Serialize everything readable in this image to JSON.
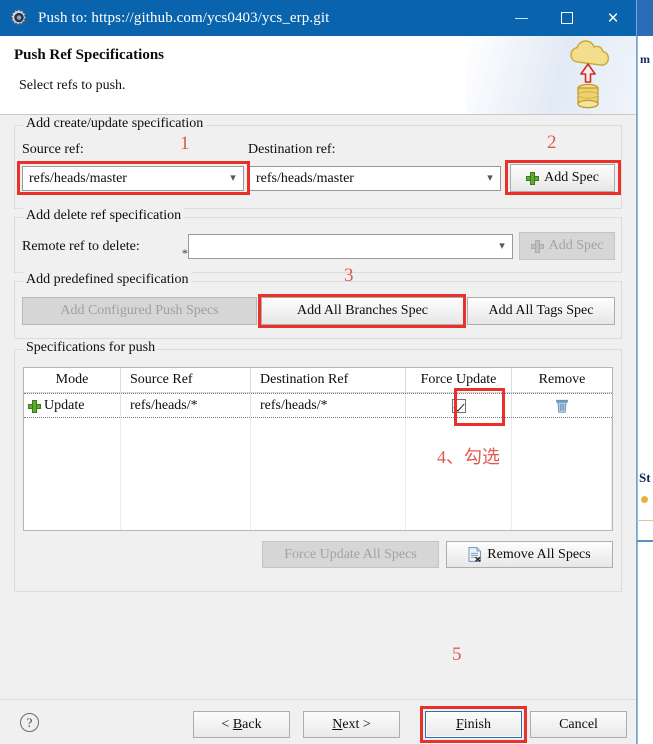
{
  "window": {
    "title": "Push to: https://github.com/ycs0403/ycs_erp.git",
    "icon": "gear-icon",
    "minimize_label": "–",
    "maximize_label": "□",
    "close_label": "×"
  },
  "banner": {
    "title": "Push Ref Specifications",
    "subtitle": "Select refs to push.",
    "art": "cloud-upload-database-icon"
  },
  "create_update_group": {
    "legend": "Add create/update specification",
    "source_label": "Source ref:",
    "source_value": "refs/heads/master",
    "destination_label": "Destination ref:",
    "destination_value": "refs/heads/master",
    "add_spec_label": "Add Spec"
  },
  "delete_group": {
    "legend": "Add delete ref specification",
    "remote_label": "Remote ref to delete:",
    "remote_value": "",
    "remote_placeholder": "",
    "required_marker": "*",
    "add_spec_label": "Add Spec"
  },
  "predefined_group": {
    "legend": "Add predefined specification",
    "add_configured_label": "Add Configured Push Specs",
    "add_all_branches_label": "Add All Branches Spec",
    "add_all_tags_label": "Add All Tags Spec"
  },
  "specs_group": {
    "legend": "Specifications for push",
    "columns": [
      "Mode",
      "Source Ref",
      "Destination Ref",
      "Force Update",
      "Remove"
    ],
    "rows": [
      {
        "mode_icon": "plus-icon",
        "mode": "Update",
        "source_ref": "refs/heads/*",
        "destination_ref": "refs/heads/*",
        "force_update": true,
        "remove_icon": "trash-icon"
      }
    ],
    "empty_row_count": 5,
    "force_update_all_label": "Force Update All Specs",
    "remove_all_label": "Remove All Specs",
    "remove_all_icon": "document-delete-icon"
  },
  "annotations": [
    {
      "id": "1",
      "text": "1"
    },
    {
      "id": "2",
      "text": "2"
    },
    {
      "id": "3",
      "text": "3"
    },
    {
      "id": "4",
      "text": "4、勾选"
    },
    {
      "id": "5",
      "text": "5"
    }
  ],
  "footer": {
    "help_label": "?",
    "back_label_prefix": "< ",
    "back_label_key": "B",
    "back_label_suffix": "ack",
    "next_label_key": "N",
    "next_label_suffix": "ext >",
    "finish_label_key": "F",
    "finish_label_suffix": "inish",
    "cancel_label": "Cancel"
  },
  "background": {
    "text_a": "m",
    "text_b": "St",
    "accent": "#e8312a",
    "titlebar_color": "#0a64ad"
  }
}
